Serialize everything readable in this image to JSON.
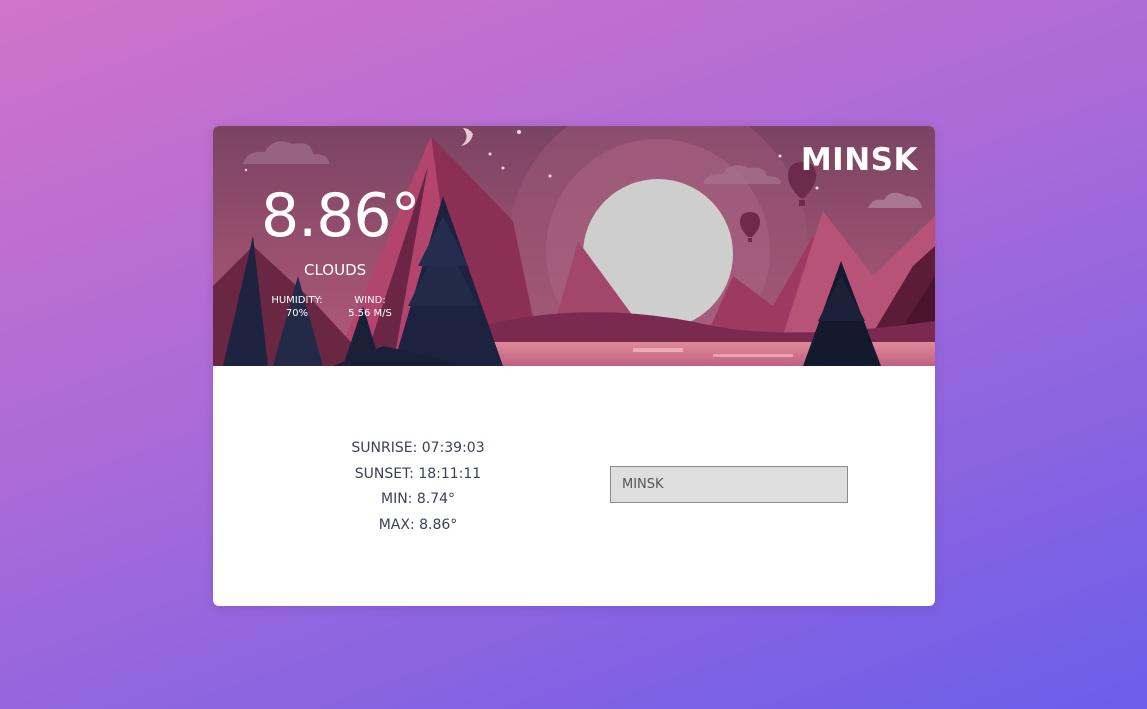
{
  "weather": {
    "city": "MINSK",
    "temperature": "8.86°",
    "description": "CLOUDS",
    "humidity_label": "HUMIDITY:",
    "humidity_value": "70%",
    "wind_label": "WIND:",
    "wind_value": "5.56 M/S"
  },
  "details": {
    "sunrise": "SUNRISE: 07:39:03",
    "sunset": "SUNSET: 18:11:11",
    "min": "MIN: 8.74°",
    "max": "MAX: 8.86°"
  },
  "search": {
    "value": "MINSK"
  },
  "colors": {
    "background_start": "#d173c9",
    "background_end": "#6b5eea",
    "scene_sky": "#8a4a68",
    "text_dark": "#3b3f5c"
  }
}
